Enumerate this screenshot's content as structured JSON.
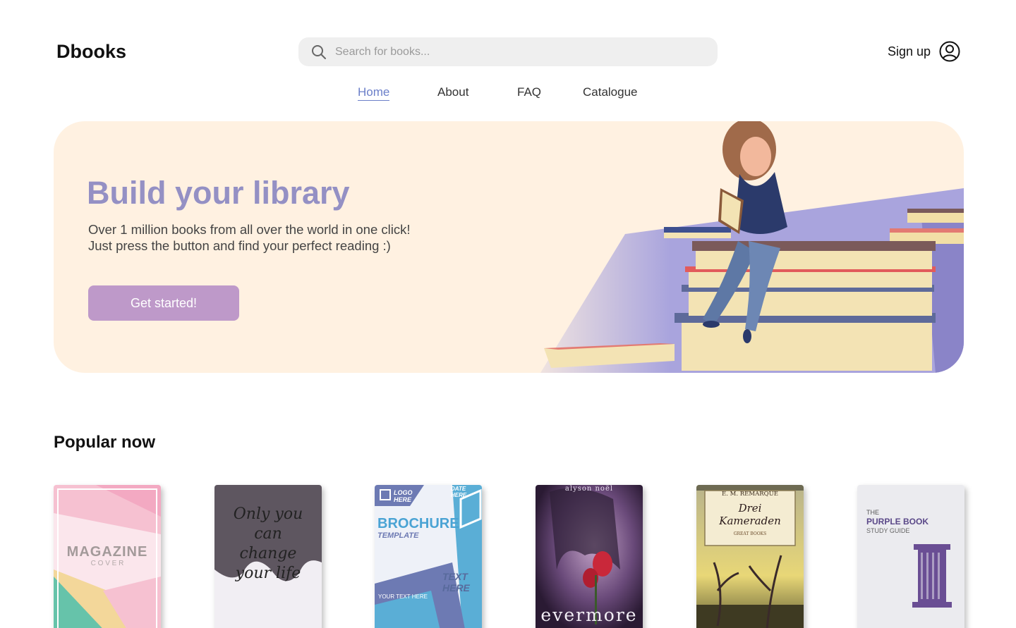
{
  "header": {
    "logo": "Dbooks",
    "search_placeholder": "Search for books...",
    "signup_label": "Sign up"
  },
  "nav": {
    "items": [
      {
        "label": "Home",
        "active": true
      },
      {
        "label": "About",
        "active": false
      },
      {
        "label": "FAQ",
        "active": false
      },
      {
        "label": "Catalogue",
        "active": false
      }
    ]
  },
  "hero": {
    "title": "Build your library",
    "subtitle_line1": "Over 1 million books from all over the world in one click!",
    "subtitle_line2": "Just press the button and find your perfect reading :)",
    "button_label": "Get started!"
  },
  "popular": {
    "title": "Popular now",
    "books": [
      {
        "cover": "magazine",
        "line1": "MAGAZINE",
        "line2": "C O V E R"
      },
      {
        "cover": "handwritten",
        "line1": "Only you can change your life"
      },
      {
        "cover": "brochure",
        "logo": "LOGO HERE",
        "date": "DATE HERE",
        "line1": "BROCHURE",
        "line2": "TEMPLATE",
        "text_here": "TEXT HERE",
        "your_text": "YOUR TEXT HERE"
      },
      {
        "cover": "evermore",
        "author": "alyson noël",
        "line1": "evermore"
      },
      {
        "cover": "remarque",
        "author": "E. M. REMARQUE",
        "line1": "Drei",
        "line2": "Kameraden",
        "badge": "GREAT BOOKS"
      },
      {
        "cover": "purple-book",
        "line1": "THE",
        "line2": "PURPLE BOOK",
        "line3": "STUDY GUIDE"
      }
    ]
  },
  "colors": {
    "accent_nav": "#6b7fc9",
    "hero_bg": "#fff1e1",
    "hero_title": "#9490c4",
    "button": "#be99c9"
  }
}
